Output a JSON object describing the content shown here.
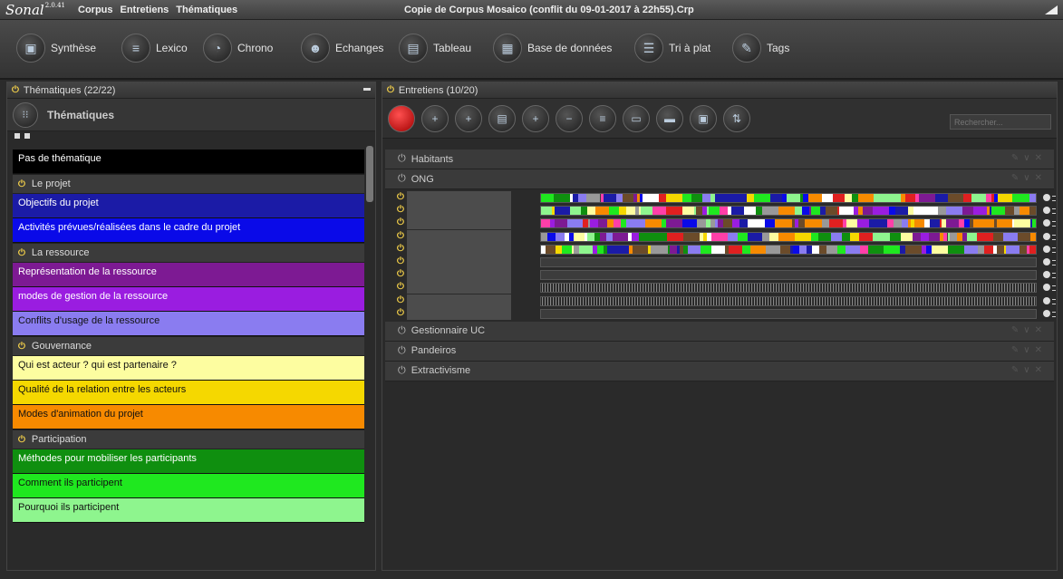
{
  "title_bar": {
    "logo": "Sonal",
    "version": "2.0.41",
    "menus": [
      "Corpus",
      "Entretiens",
      "Thématiques"
    ],
    "window_title": "Copie de Corpus Mosaico (conflit du 09-01-2017 à 22h55).Crp"
  },
  "toolbar": {
    "buttons": [
      {
        "label": "Synthèse",
        "icon": "synthese-icon"
      },
      {
        "label": "Lexico",
        "icon": "lexico-icon"
      },
      {
        "label": "Chrono",
        "icon": "chrono-icon"
      },
      {
        "label": "Echanges",
        "icon": "echanges-icon"
      },
      {
        "label": "Tableau",
        "icon": "tableau-icon"
      },
      {
        "label": "Base de données",
        "icon": "database-icon"
      },
      {
        "label": "Tri à plat",
        "icon": "tri-icon"
      },
      {
        "label": "Tags",
        "icon": "tags-icon"
      }
    ]
  },
  "left_panel": {
    "header": "Thématiques (22/22)",
    "subheader": "Thématiques",
    "items": [
      {
        "kind": "theme",
        "label": "Pas de thématique",
        "color": "#000000",
        "text_color": "#ffffff"
      },
      {
        "kind": "group",
        "label": "Le projet"
      },
      {
        "kind": "theme",
        "label": "Objectifs du projet",
        "color": "#1b1ba6",
        "text_color": "#ffffff"
      },
      {
        "kind": "theme",
        "label": "Activités prévues/réalisées dans le cadre du projet",
        "color": "#0a0ae8",
        "text_color": "#ffffff"
      },
      {
        "kind": "group",
        "label": "La ressource"
      },
      {
        "kind": "theme",
        "label": "Représentation de la ressource",
        "color": "#7d1a93",
        "text_color": "#ffffff"
      },
      {
        "kind": "theme",
        "label": "modes de gestion de la ressource",
        "color": "#9a1de0",
        "text_color": "#ffffff"
      },
      {
        "kind": "theme",
        "label": "Conflits d'usage de la ressource",
        "color": "#8a7cf0",
        "text_color": "#111111"
      },
      {
        "kind": "group",
        "label": "Gouvernance"
      },
      {
        "kind": "theme",
        "label": "Qui est acteur ? qui est partenaire ?",
        "color": "#fdfda0",
        "text_color": "#111111"
      },
      {
        "kind": "theme",
        "label": "Qualité de la relation entre les acteurs",
        "color": "#f5d800",
        "text_color": "#111111"
      },
      {
        "kind": "theme",
        "label": "Modes d'animation du projet",
        "color": "#f78a00",
        "text_color": "#111111"
      },
      {
        "kind": "group",
        "label": "Participation"
      },
      {
        "kind": "theme",
        "label": "Méthodes pour mobiliser les participants",
        "color": "#0f8f0f",
        "text_color": "#ffffff"
      },
      {
        "kind": "theme",
        "label": "Comment ils participent",
        "color": "#1fe81f",
        "text_color": "#111111"
      },
      {
        "kind": "theme",
        "label": "Pourquoi ils participent",
        "color": "#8ef58e",
        "text_color": "#111111"
      }
    ]
  },
  "right_panel": {
    "header": "Entretiens (10/20)",
    "search_placeholder": "Rechercher...",
    "action_icons": [
      "record-icon",
      "add-media-icon",
      "add-file-icon",
      "document-icon",
      "add-person-icon",
      "remove-person-icon",
      "list-icon",
      "edit-list-icon",
      "timeline-icon",
      "settings-list-icon",
      "sort-icon"
    ],
    "groups": [
      {
        "label": "Habitants",
        "expanded": false
      },
      {
        "label": "ONG",
        "expanded": true
      },
      {
        "label": "Gestionnaire UC",
        "expanded": false
      },
      {
        "label": "Pandeiros",
        "expanded": false
      },
      {
        "label": "Extractivisme",
        "expanded": false
      }
    ],
    "interviews": [
      {
        "name": "",
        "style": "colored",
        "fill": 1.0
      },
      {
        "name": "",
        "style": "colored",
        "fill": 1.0
      },
      {
        "name": "",
        "style": "colored",
        "fill": 1.0
      },
      {
        "name": "",
        "style": "colored",
        "fill": 1.0
      },
      {
        "name": "",
        "style": "colored",
        "fill": 1.0
      },
      {
        "name": "",
        "style": "empty",
        "fill": 0.0
      },
      {
        "name": "",
        "style": "empty",
        "fill": 0.0
      },
      {
        "name": "",
        "style": "waveform",
        "fill": 1.0
      },
      {
        "name": "",
        "style": "waveform",
        "fill": 1.0
      },
      {
        "name": "",
        "style": "empty",
        "fill": 0.0
      }
    ],
    "bar_palette": [
      "#1b1ba6",
      "#0a0ae8",
      "#7d1a93",
      "#9a1de0",
      "#8a7cf0",
      "#fdfda0",
      "#f5d800",
      "#f78a00",
      "#0f8f0f",
      "#1fe81f",
      "#8ef58e",
      "#ff3fa8",
      "#e02020",
      "#999999",
      "#ffffff",
      "#6b4b2a"
    ]
  }
}
